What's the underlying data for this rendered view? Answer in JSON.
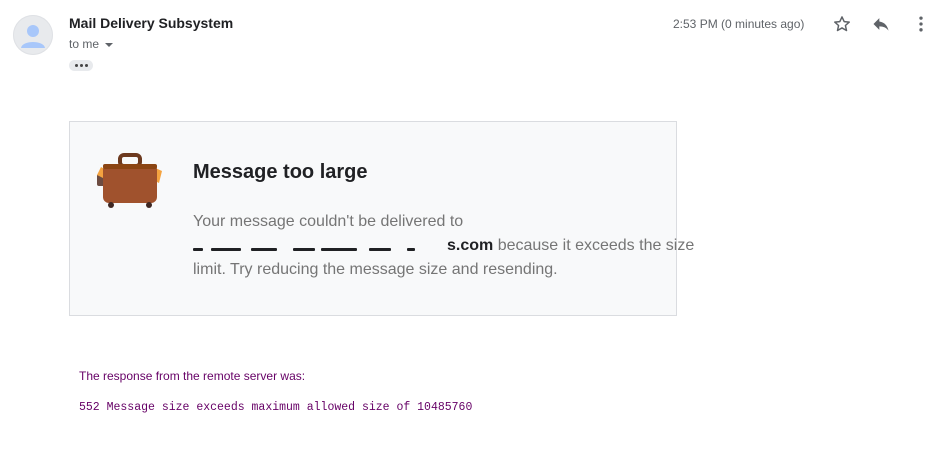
{
  "header": {
    "sender_name": "Mail Delivery Subsystem",
    "recipient_label": "to me",
    "timestamp": "2:53 PM (0 minutes ago)",
    "icons": {
      "avatar": "person-icon",
      "star": "star-icon",
      "reply": "reply-icon",
      "more": "more-vert-icon",
      "recipient_dropdown": "chevron-down-icon",
      "trimmed_content": "ellipsis-icon"
    }
  },
  "card": {
    "icon": "suitcase-icon",
    "title": "Message too large",
    "body_line1": "Your message couldn't be delivered to",
    "address_suffix": "s.com",
    "body_line2_rest": " because it exceeds the size",
    "body_line3": "limit. Try reducing the message size and resending."
  },
  "server": {
    "label": "The response from the remote server was:",
    "response": "552 Message size exceeds maximum allowed size of 10485760"
  },
  "colors": {
    "server_text": "#660066",
    "suitcase": "#a0522d",
    "card_background": "#f8f9fa"
  }
}
